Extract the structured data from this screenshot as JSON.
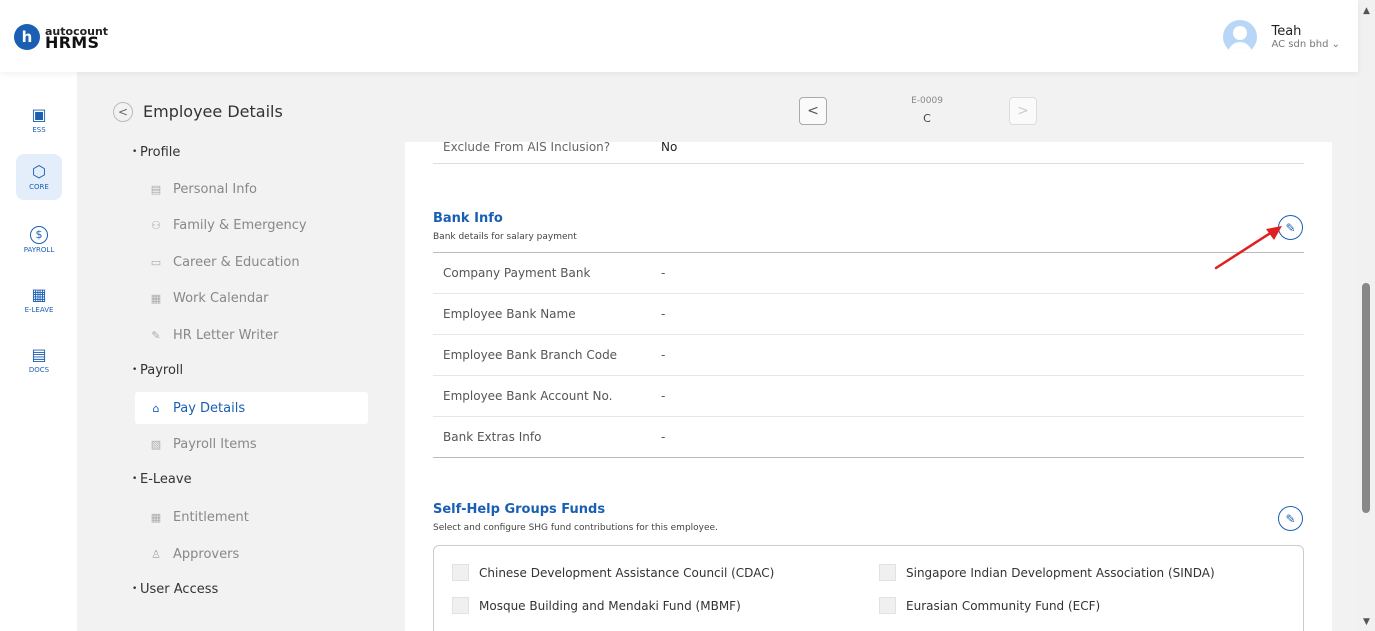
{
  "brand": {
    "logo_letter": "h",
    "name_top": "autocount",
    "name_bottom": "HRMS"
  },
  "user": {
    "name": "Teah",
    "company": "AC sdn bhd",
    "company_chevron": "⌄"
  },
  "rail": [
    {
      "label": "ESS",
      "icon": "ess-icon",
      "glyph": "▣",
      "active": false
    },
    {
      "label": "CORE",
      "icon": "core-cube-icon",
      "glyph": "⬡",
      "active": true
    },
    {
      "label": "PAYROLL",
      "icon": "payroll-dollar-icon",
      "glyph": "$",
      "active": false
    },
    {
      "label": "E-LEAVE",
      "icon": "calendar-icon",
      "glyph": "▦",
      "active": false
    },
    {
      "label": "DOCS",
      "icon": "document-chart-icon",
      "glyph": "▤",
      "active": false
    }
  ],
  "page": {
    "title": "Employee Details",
    "employee_code": "E-0009",
    "employee_name": "C",
    "prev_glyph": "<",
    "next_glyph": ">",
    "back_glyph": "<"
  },
  "submenu": {
    "profile": "Profile",
    "personal_info": "Personal Info",
    "family_emergency": "Family & Emergency",
    "career_education": "Career & Education",
    "work_calendar": "Work Calendar",
    "hr_letter_writer": "HR Letter Writer",
    "payroll": "Payroll",
    "pay_details": "Pay Details",
    "payroll_items": "Payroll Items",
    "eleave": "E-Leave",
    "entitlement": "Entitlement",
    "approvers": "Approvers",
    "user_access": "User Access"
  },
  "prev_field": {
    "label": "Exclude From AIS Inclusion?",
    "value": "No"
  },
  "bank_info": {
    "title": "Bank Info",
    "subtitle": "Bank details for salary payment",
    "rows": [
      {
        "label": "Company Payment Bank",
        "value": "-"
      },
      {
        "label": "Employee Bank Name",
        "value": "-"
      },
      {
        "label": "Employee Bank Branch Code",
        "value": "-"
      },
      {
        "label": "Employee Bank Account No.",
        "value": "-"
      },
      {
        "label": "Bank Extras Info",
        "value": "-"
      }
    ]
  },
  "shg": {
    "title": "Self-Help Groups Funds",
    "subtitle": "Select and configure SHG fund contributions for this employee.",
    "funds": [
      "Chinese Development Assistance Council (CDAC)",
      "Singapore Indian Development Association (SINDA)",
      "Mosque Building and Mendaki Fund (MBMF)",
      "Eurasian Community Fund (ECF)"
    ]
  },
  "edit_glyph": "✎",
  "colors": {
    "accent": "#1a5fb4",
    "arrow": "#e02020"
  }
}
